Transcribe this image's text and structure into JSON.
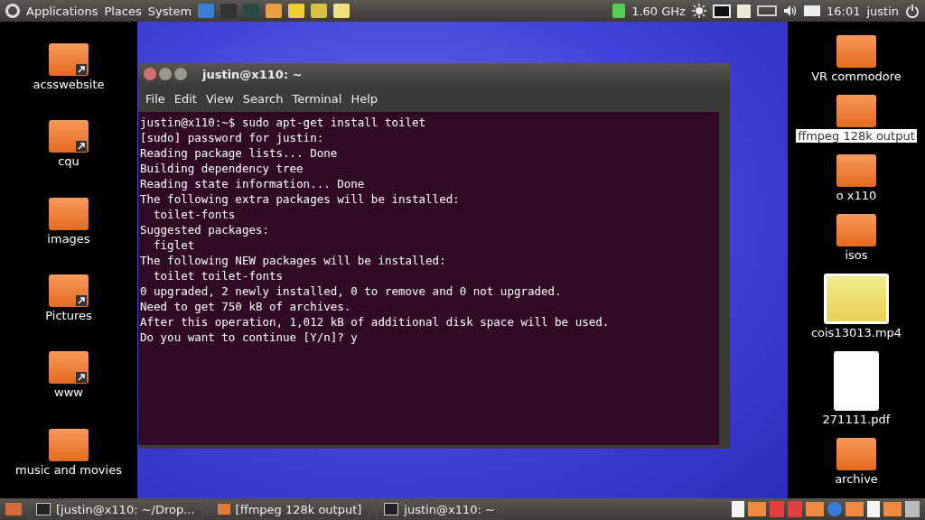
{
  "top_panel": {
    "menus": [
      "Applications",
      "Places",
      "System"
    ],
    "launchers": [
      {
        "kind": "mail"
      },
      {
        "kind": "terminal"
      },
      {
        "kind": "monitor"
      },
      {
        "kind": "monkey"
      },
      {
        "kind": "note"
      },
      {
        "kind": "screen"
      },
      {
        "kind": "folder"
      }
    ],
    "cpu_frequency": "1.60 GHz",
    "clock": "16:01",
    "user": "justin"
  },
  "desktop_left": [
    {
      "label": "acsswebsite",
      "kind": "folder",
      "link": true,
      "selected": false
    },
    {
      "label": "cqu",
      "kind": "folder",
      "link": true,
      "selected": false
    },
    {
      "label": "images",
      "kind": "folder",
      "link": false,
      "selected": false
    },
    {
      "label": "Pictures",
      "kind": "folder",
      "link": true,
      "selected": false
    },
    {
      "label": "www",
      "kind": "folder",
      "link": true,
      "selected": false
    },
    {
      "label": "music and movies",
      "kind": "folder",
      "link": false,
      "selected": false
    }
  ],
  "desktop_right": [
    {
      "label": "VR commodore",
      "kind": "folder",
      "selected": false
    },
    {
      "label": "ffmpeg 128k output",
      "kind": "folder",
      "selected": true
    },
    {
      "label": "o x110",
      "kind": "folder",
      "selected": false
    },
    {
      "label": "isos",
      "kind": "folder",
      "selected": false
    },
    {
      "label": "cois13013.mp4",
      "kind": "video",
      "selected": false
    },
    {
      "label": "271111.pdf",
      "kind": "pdf",
      "selected": false
    },
    {
      "label": "archive",
      "kind": "folder",
      "selected": false
    }
  ],
  "terminal": {
    "title": "justin@x110: ~",
    "menu": [
      "File",
      "Edit",
      "View",
      "Search",
      "Terminal",
      "Help"
    ],
    "lines": [
      "justin@x110:~$ sudo apt-get install toilet",
      "[sudo] password for justin:",
      "Reading package lists... Done",
      "Building dependency tree",
      "Reading state information... Done",
      "The following extra packages will be installed:",
      "  toilet-fonts",
      "Suggested packages:",
      "  figlet",
      "The following NEW packages will be installed:",
      "  toilet toilet-fonts",
      "0 upgraded, 2 newly installed, 0 to remove and 0 not upgraded.",
      "Need to get 750 kB of archives.",
      "After this operation, 1,012 kB of additional disk space will be used.",
      "Do you want to continue [Y/n]? y"
    ]
  },
  "taskbar": {
    "windows": [
      {
        "label": "[justin@x110: ~/Drop...",
        "kind": "terminal"
      },
      {
        "label": "[ffmpeg 128k output]",
        "kind": "folder"
      },
      {
        "label": "justin@x110: ~",
        "kind": "terminal"
      }
    ]
  }
}
